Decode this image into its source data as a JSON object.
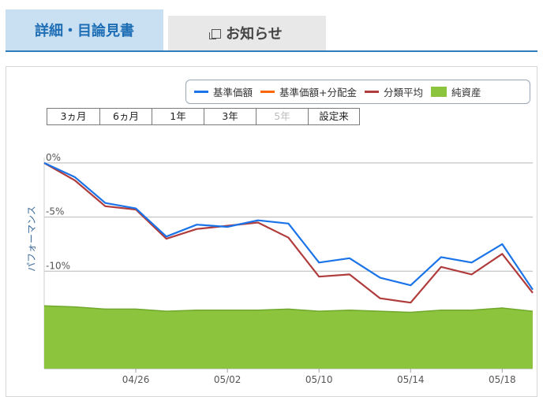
{
  "tabs": [
    {
      "label": "詳細・目論見書",
      "active": true
    },
    {
      "label": "お知らせ",
      "active": false,
      "icon": "external-window-icon"
    }
  ],
  "ranges": [
    {
      "label": "3ヵ月",
      "enabled": true
    },
    {
      "label": "6ヵ月",
      "enabled": true
    },
    {
      "label": "1年",
      "enabled": true
    },
    {
      "label": "3年",
      "enabled": true
    },
    {
      "label": "5年",
      "enabled": false
    },
    {
      "label": "設定来",
      "enabled": true
    }
  ],
  "chart_data": {
    "type": "line",
    "ylabel": "パフォーマンス",
    "yticks": [
      "0%",
      "-5%",
      "-10%"
    ],
    "ylim": [
      -19,
      0.5
    ],
    "x_ticks": [
      "04/26",
      "05/02",
      "05/10",
      "05/14",
      "05/18"
    ],
    "legend": [
      {
        "name": "基準価額",
        "color": "#1a73e8",
        "kind": "line"
      },
      {
        "name": "基準価額+分配金",
        "color": "#ff6600",
        "kind": "line"
      },
      {
        "name": "分類平均",
        "color": "#b03c3c",
        "kind": "line"
      },
      {
        "name": "純資産",
        "color": "#8cc43e",
        "kind": "area"
      }
    ],
    "series": [
      {
        "name": "基準価額",
        "color": "#1a73e8",
        "values": [
          0,
          -1.3,
          -3.7,
          -4.2,
          -6.8,
          -5.7,
          -5.9,
          -5.3,
          -5.6,
          -9.2,
          -8.8,
          -10.6,
          -11.3,
          -8.7,
          -9.2,
          -7.5,
          -11.7
        ]
      },
      {
        "name": "分類平均",
        "color": "#b03c3c",
        "values": [
          0,
          -1.6,
          -4.0,
          -4.3,
          -7.0,
          -6.1,
          -5.8,
          -5.5,
          -6.9,
          -10.5,
          -10.3,
          -12.5,
          -12.9,
          -9.6,
          -10.3,
          -8.4,
          -12.0
        ]
      },
      {
        "name": "純資産",
        "color": "#8cc43e",
        "values": [
          -13.2,
          -13.3,
          -13.5,
          -13.5,
          -13.7,
          -13.6,
          -13.6,
          -13.6,
          -13.5,
          -13.7,
          -13.6,
          -13.7,
          -13.8,
          -13.6,
          -13.6,
          -13.4,
          -13.7
        ]
      }
    ]
  }
}
